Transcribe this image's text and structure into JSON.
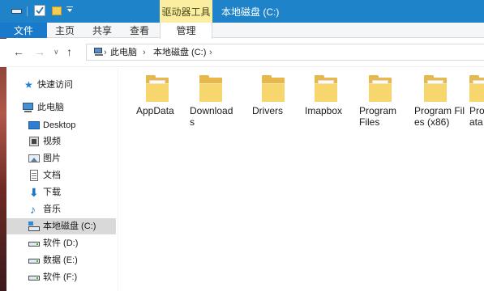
{
  "titlebar": {
    "contextual_tab": "驱动器工具",
    "title": "本地磁盘 (C:)"
  },
  "ribbon": {
    "file": "文件",
    "home": "主页",
    "share": "共享",
    "view": "查看",
    "manage": "管理"
  },
  "nav_buttons": {
    "back": "←",
    "forward": "→",
    "recent": "∨",
    "up": "↑"
  },
  "address": {
    "crumbs": [
      "此电脑",
      "本地磁盘 (C:)"
    ],
    "separator": "›"
  },
  "navpane": {
    "quick_access": "快速访问",
    "this_pc": "此电脑",
    "items": [
      {
        "label": "Desktop",
        "icon": "desktop-icon"
      },
      {
        "label": "视频",
        "icon": "video-icon"
      },
      {
        "label": "图片",
        "icon": "pictures-icon"
      },
      {
        "label": "文档",
        "icon": "documents-icon"
      },
      {
        "label": "下载",
        "icon": "downloads-icon"
      },
      {
        "label": "音乐",
        "icon": "music-icon"
      },
      {
        "label": "本地磁盘 (C:)",
        "icon": "local-disk-icon",
        "selected": true
      },
      {
        "label": "软件 (D:)",
        "icon": "drive-icon"
      },
      {
        "label": "数据 (E:)",
        "icon": "drive-icon"
      },
      {
        "label": "软件 (F:)",
        "icon": "drive-icon"
      }
    ]
  },
  "folders": [
    {
      "name": "AppData"
    },
    {
      "name": "Downloads"
    },
    {
      "name": "Drivers"
    },
    {
      "name": "Imapbox"
    },
    {
      "name": "Program Files"
    },
    {
      "name": "Program Files (x86)"
    },
    {
      "name": "Pro ata"
    }
  ],
  "colors": {
    "titlebar": "#1e83c9",
    "file_tab": "#1979ca",
    "contextual_tab": "#fbeea1",
    "selected_item": "#d9d9d9",
    "folder": "#f7d66e"
  }
}
